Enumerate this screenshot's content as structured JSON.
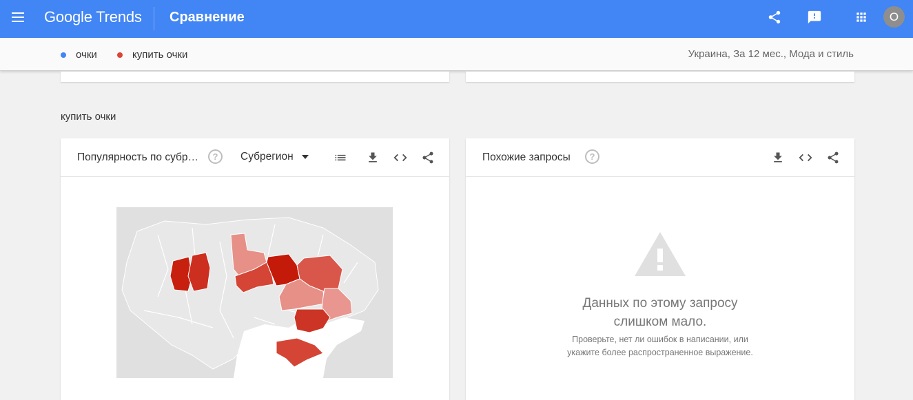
{
  "app": {
    "brand": "Google Trends",
    "page_title": "Сравнение",
    "avatar_letter": "O",
    "colors": {
      "appbar": "#4285f4",
      "series1": "#4285f4",
      "series2": "#db4437"
    }
  },
  "header_icons": [
    "share-icon",
    "feedback-icon",
    "apps-grid-icon"
  ],
  "subheader": {
    "terms": [
      {
        "label": "очки",
        "color": "#4285f4"
      },
      {
        "label": "купить очки",
        "color": "#db4437"
      }
    ],
    "filters": "Украина, За 12 мес., Мода и стиль"
  },
  "section": {
    "title": "купить очки"
  },
  "region_card": {
    "title": "Популярность по субр…",
    "select_value": "Субрегион",
    "icons": [
      "help-icon",
      "list-icon",
      "download-icon",
      "embed-code-icon",
      "share-icon"
    ]
  },
  "related_card": {
    "title": "Похожие запросы",
    "icons": [
      "help-icon",
      "download-icon",
      "embed-code-icon",
      "share-icon"
    ],
    "empty_line1": "Данных по этому запросу",
    "empty_line2": "слишком мало.",
    "hint_line1": "Проверьте, нет ли ошибок в написании, или",
    "hint_line2": "укажите более распространенное выражение."
  },
  "map_colors": {
    "background": "#e0e0e0",
    "land": "#e8e8e8",
    "dark": "#c8200e",
    "medium": "#d9574a",
    "light": "#e69088",
    "lightest": "#eeb0aa",
    "sea": "#ffffff"
  }
}
